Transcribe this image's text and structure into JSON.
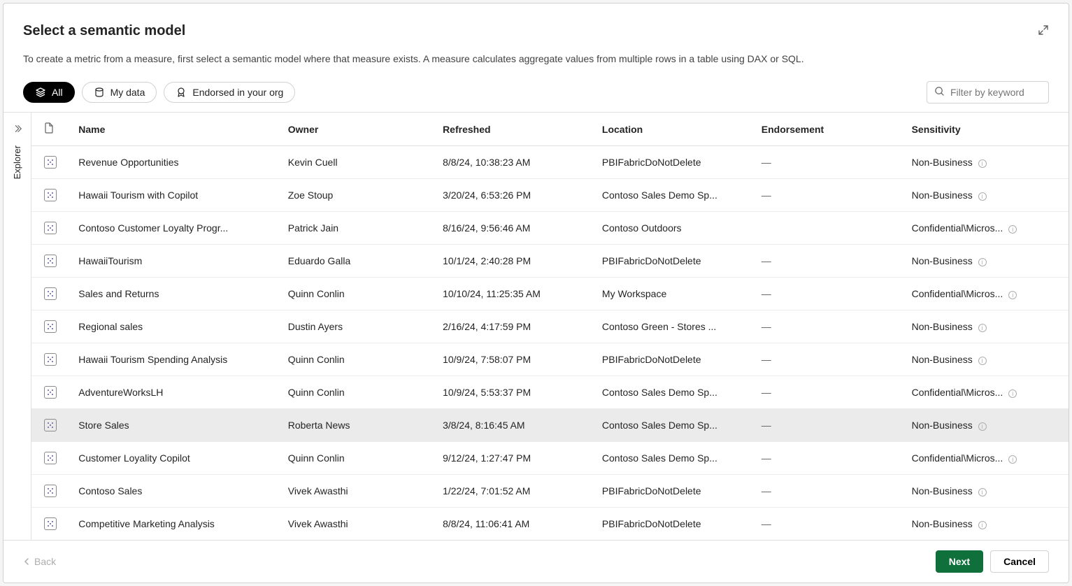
{
  "dialog": {
    "title": "Select a semantic model",
    "description": "To create a metric from a measure, first select a semantic model where that measure exists. A measure calculates aggregate values from multiple rows in a table using DAX or SQL."
  },
  "filters": {
    "pills": [
      {
        "label": "All",
        "active": true
      },
      {
        "label": "My data",
        "active": false
      },
      {
        "label": "Endorsed in your org",
        "active": false
      }
    ],
    "search_placeholder": "Filter by keyword"
  },
  "sidebar": {
    "label": "Explorer"
  },
  "columns": {
    "name": "Name",
    "owner": "Owner",
    "refreshed": "Refreshed",
    "location": "Location",
    "endorsement": "Endorsement",
    "sensitivity": "Sensitivity"
  },
  "rows": [
    {
      "name": "Revenue Opportunities",
      "owner": "Kevin Cuell",
      "refreshed": "8/8/24, 10:38:23 AM",
      "location": "PBIFabricDoNotDelete",
      "endorsement": "—",
      "sensitivity": "Non-Business",
      "selected": false
    },
    {
      "name": "Hawaii Tourism with Copilot",
      "owner": "Zoe Stoup",
      "refreshed": "3/20/24, 6:53:26 PM",
      "location": "Contoso Sales Demo Sp...",
      "endorsement": "—",
      "sensitivity": "Non-Business",
      "selected": false
    },
    {
      "name": "Contoso Customer Loyalty Progr...",
      "owner": "Patrick Jain",
      "refreshed": "8/16/24, 9:56:46 AM",
      "location": "Contoso Outdoors",
      "endorsement": "",
      "sensitivity": "Confidential\\Micros...",
      "selected": false
    },
    {
      "name": "HawaiiTourism",
      "owner": "Eduardo Galla",
      "refreshed": "10/1/24, 2:40:28 PM",
      "location": "PBIFabricDoNotDelete",
      "endorsement": "—",
      "sensitivity": "Non-Business",
      "selected": false
    },
    {
      "name": "Sales and Returns",
      "owner": "Quinn Conlin",
      "refreshed": "10/10/24, 11:25:35 AM",
      "location": "My Workspace",
      "endorsement": "—",
      "sensitivity": "Confidential\\Micros...",
      "selected": false
    },
    {
      "name": "Regional sales",
      "owner": "Dustin Ayers",
      "refreshed": "2/16/24, 4:17:59 PM",
      "location": "Contoso Green - Stores ...",
      "endorsement": "—",
      "sensitivity": "Non-Business",
      "selected": false
    },
    {
      "name": "Hawaii Tourism Spending Analysis",
      "owner": "Quinn Conlin",
      "refreshed": "10/9/24, 7:58:07 PM",
      "location": "PBIFabricDoNotDelete",
      "endorsement": "—",
      "sensitivity": "Non-Business",
      "selected": false
    },
    {
      "name": "AdventureWorksLH",
      "owner": "Quinn Conlin",
      "refreshed": "10/9/24, 5:53:37 PM",
      "location": "Contoso Sales Demo Sp...",
      "endorsement": "—",
      "sensitivity": "Confidential\\Micros...",
      "selected": false
    },
    {
      "name": "Store Sales",
      "owner": "Roberta News",
      "refreshed": "3/8/24, 8:16:45 AM",
      "location": "Contoso Sales Demo Sp...",
      "endorsement": "—",
      "sensitivity": "Non-Business",
      "selected": true
    },
    {
      "name": "Customer Loyality Copilot",
      "owner": "Quinn Conlin",
      "refreshed": "9/12/24, 1:27:47 PM",
      "location": "Contoso Sales Demo Sp...",
      "endorsement": "—",
      "sensitivity": "Confidential\\Micros...",
      "selected": false
    },
    {
      "name": "Contoso Sales",
      "owner": "Vivek Awasthi",
      "refreshed": "1/22/24, 7:01:52 AM",
      "location": "PBIFabricDoNotDelete",
      "endorsement": "—",
      "sensitivity": "Non-Business",
      "selected": false
    },
    {
      "name": "Competitive Marketing Analysis",
      "owner": "Vivek Awasthi",
      "refreshed": "8/8/24, 11:06:41 AM",
      "location": "PBIFabricDoNotDelete",
      "endorsement": "—",
      "sensitivity": "Non-Business",
      "selected": false
    }
  ],
  "footer": {
    "back": "Back",
    "next": "Next",
    "cancel": "Cancel"
  }
}
